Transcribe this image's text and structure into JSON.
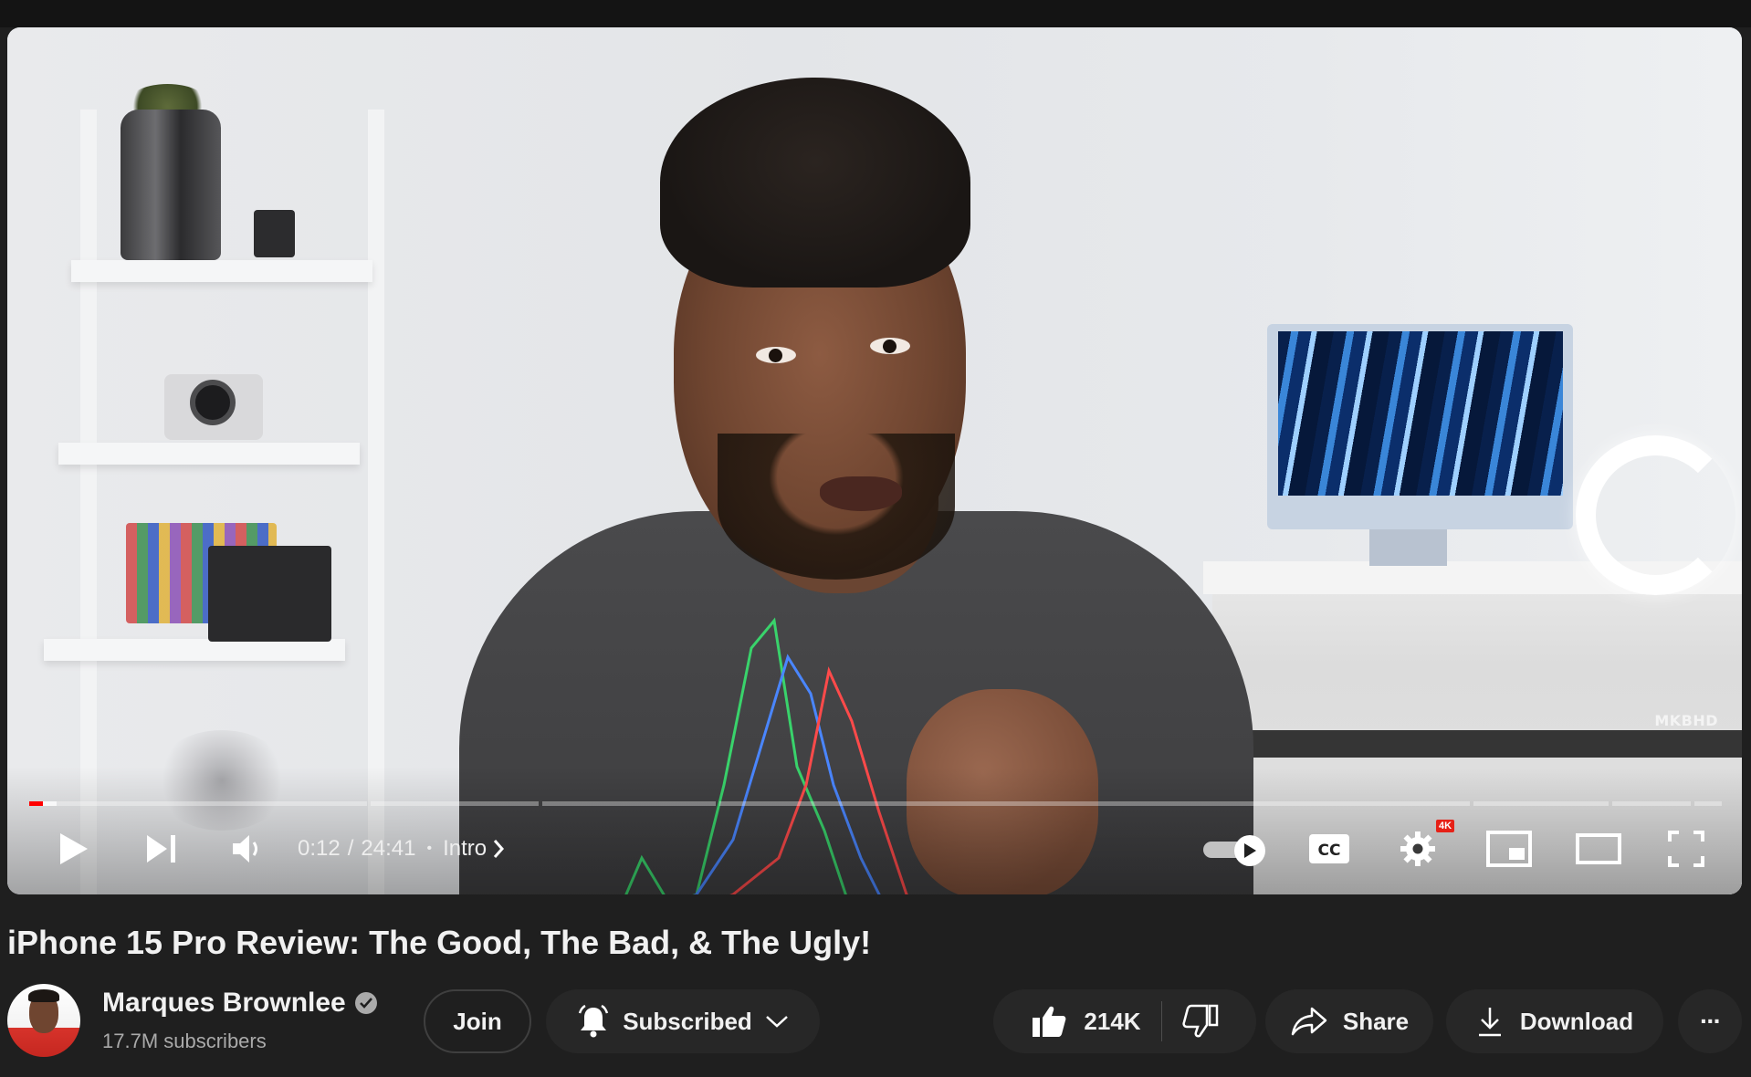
{
  "player": {
    "watermark": "MKBHD",
    "progress": {
      "current_seconds": 12,
      "duration_seconds": 1481,
      "buffered_seconds": 24
    },
    "time_current": "0:12",
    "time_separator": "/",
    "time_duration": "24:41",
    "chapter_label": "Intro",
    "quality_badge": "4K",
    "icons": {
      "play": "play-icon",
      "next": "skip-next-icon",
      "volume": "volume-icon",
      "chapter_chevron": "chevron-right-icon",
      "autoplay": "autoplay-toggle-icon",
      "captions": "cc-icon",
      "settings": "gear-icon",
      "miniplayer": "miniplayer-icon",
      "theater": "theater-mode-icon",
      "fullscreen": "fullscreen-icon"
    }
  },
  "video": {
    "title": "iPhone 15 Pro Review: The Good, The Bad, & The Ugly!"
  },
  "channel": {
    "name": "Marques Brownlee",
    "subscribers": "17.7M subscribers",
    "verified": true
  },
  "actions": {
    "join_label": "Join",
    "subscribed_label": "Subscribed",
    "like_count": "214K",
    "share_label": "Share",
    "download_label": "Download",
    "more_label": "···"
  },
  "colors": {
    "accent": "#ff0000",
    "background": "#1f1f1f",
    "pill_background": "#272727",
    "secondary_text": "#aaaaaa"
  }
}
